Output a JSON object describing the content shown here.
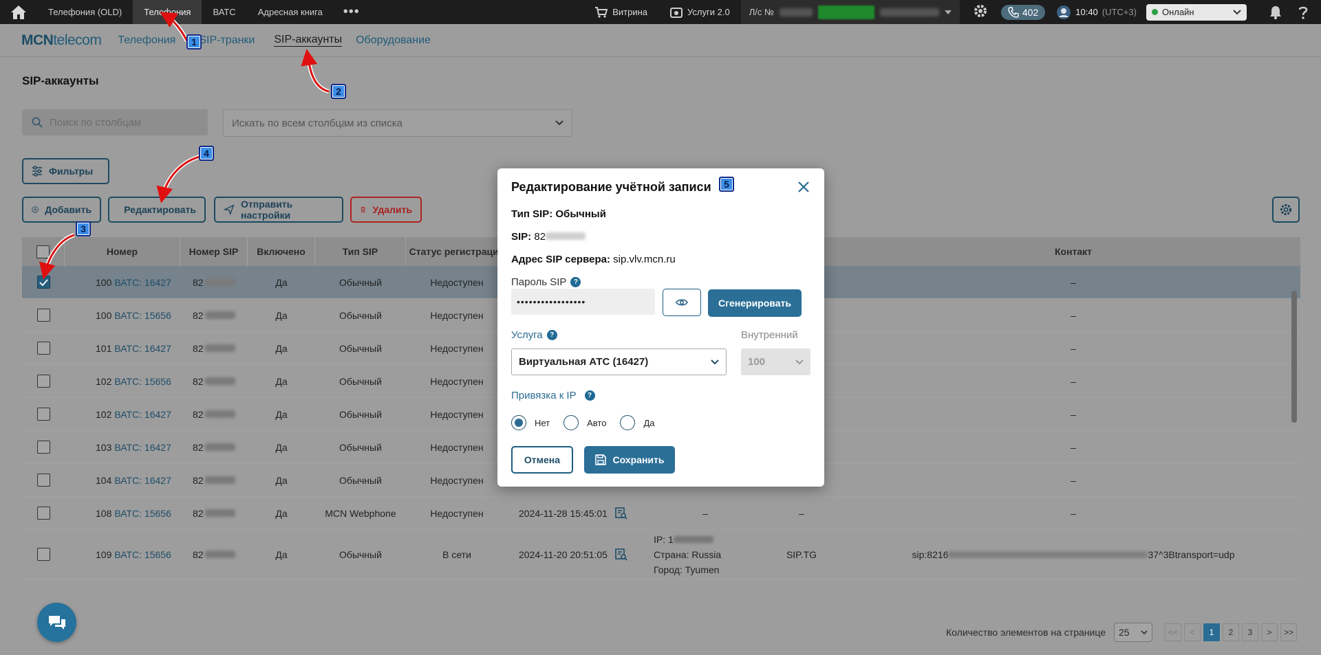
{
  "topbar": {
    "tabs": [
      "Телефония (OLD)",
      "Телефония",
      "ВАТС",
      "Адресная книга"
    ],
    "more": "•••",
    "shop": "Витрина",
    "services": "Услуги 2.0",
    "account_label": "Л/с №",
    "phone_count": "402",
    "time": "10:40",
    "timezone": "(UTC+3)",
    "status": "Онлайн",
    "status_color": "#2aa043"
  },
  "subnav": {
    "logo_bold": "MCN",
    "logo_rest": "telecom",
    "items": [
      "Телефония",
      "SIP-транки",
      "SIP-аккаунты",
      "Оборудование"
    ]
  },
  "page": {
    "title": "SIP-аккаунты",
    "search_placeholder": "Поиск по столбцам",
    "columns_select": "Искать по всем столбцам из списка",
    "filters": "Фильтры",
    "add": "Добавить",
    "edit": "Редактировать",
    "send": "Отправить настройки",
    "delete": "Удалить"
  },
  "table": {
    "headers": [
      "Номер",
      "Номер SIP",
      "Включено",
      "Тип SIP",
      "Статус регистрации",
      "Контакт"
    ],
    "rows": [
      {
        "num": "100",
        "vats": "ВАТС: 16427",
        "sip": "82",
        "on": "Да",
        "type": "Обычный",
        "status": "Недоступен",
        "date": "",
        "contact": "–"
      },
      {
        "num": "100",
        "vats": "ВАТС: 15656",
        "sip": "82",
        "on": "Да",
        "type": "Обычный",
        "status": "Недоступен",
        "date": "",
        "contact": "–"
      },
      {
        "num": "101",
        "vats": "ВАТС: 16427",
        "sip": "82",
        "on": "Да",
        "type": "Обычный",
        "status": "Недоступен",
        "date": "",
        "contact": "–"
      },
      {
        "num": "102",
        "vats": "ВАТС: 15656",
        "sip": "82",
        "on": "Да",
        "type": "Обычный",
        "status": "Недоступен",
        "date": "",
        "contact": "–"
      },
      {
        "num": "102",
        "vats": "ВАТС: 16427",
        "sip": "82",
        "on": "Да",
        "type": "Обычный",
        "status": "Недоступен",
        "date": "",
        "contact": "–"
      },
      {
        "num": "103",
        "vats": "ВАТС: 16427",
        "sip": "82",
        "on": "Да",
        "type": "Обычный",
        "status": "Недоступен",
        "date": "",
        "contact": "–"
      },
      {
        "num": "104",
        "vats": "ВАТС: 16427",
        "sip": "82",
        "on": "Да",
        "type": "Обычный",
        "status": "Недоступен",
        "date": "",
        "contact": "–"
      },
      {
        "num": "108",
        "vats": "ВАТС: 15656",
        "sip": "82",
        "on": "Да",
        "type": "MCN Webphone",
        "status": "Недоступен",
        "date": "2024-11-28 15:45:01",
        "ip": "–",
        "ua": "–",
        "contact": "–"
      },
      {
        "num": "109",
        "vats": "ВАТС: 15656",
        "sip": "82",
        "on": "Да",
        "type": "Обычный",
        "status": "В сети",
        "date": "2024-11-20 20:51:05",
        "ip_line": "IP: 1",
        "country": "Страна: Russia",
        "city": "Город: Tyumen",
        "ua": "SIP.TG",
        "contact_prefix": "sip:8216",
        "contact_suffix": "37^3Btransport=udp"
      }
    ]
  },
  "pager": {
    "label": "Количество элементов на странице",
    "per_page": "25",
    "first": "<<",
    "prev": "<",
    "pages": [
      "1",
      "2",
      "3"
    ],
    "next": ">",
    "last": ">>"
  },
  "modal": {
    "title": "Редактирование учётной записи",
    "sip_type": "Тип SIP: Обычный",
    "sip_label": "SIP:",
    "sip_value": "82",
    "server_label": "Адрес SIP сервера:",
    "server_value": "sip.vlv.mcn.ru",
    "password_label": "Пароль SIP",
    "password_value": "•••••••••••••••••",
    "generate": "Сгенерировать",
    "service_label": "Услуга",
    "service_value": "Виртуальная АТС (16427)",
    "internal_label": "Внутренний",
    "internal_value": "100",
    "ip_bind_label": "Привязка к IP",
    "radio": [
      "Нет",
      "Авто",
      "Да"
    ],
    "cancel": "Отмена",
    "save": "Сохранить"
  },
  "markers": [
    "1",
    "2",
    "3",
    "4",
    "5"
  ]
}
